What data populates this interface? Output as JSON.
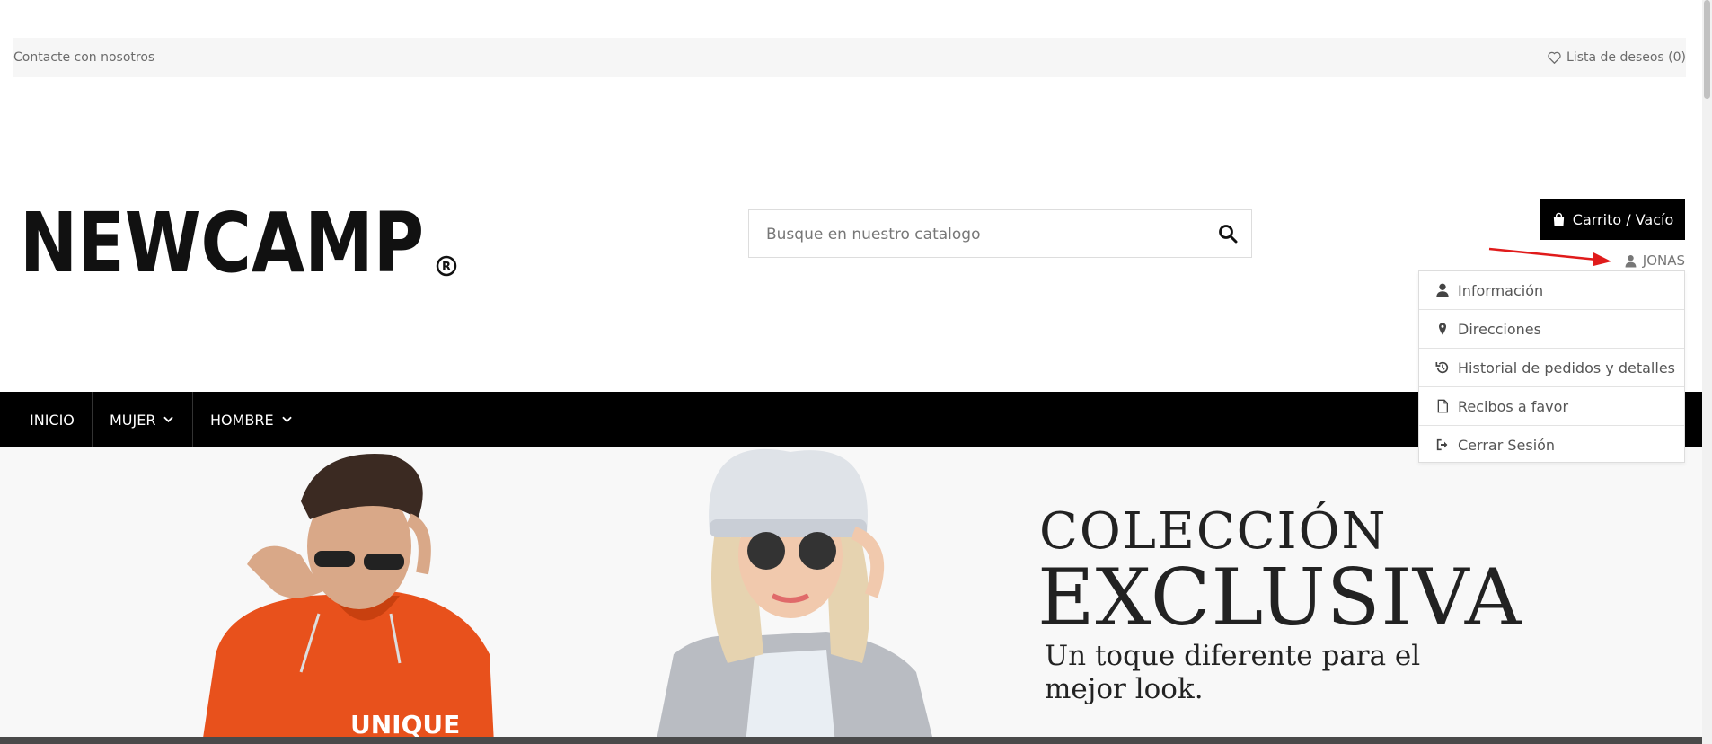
{
  "topbar": {
    "contact": "Contacte con nosotros",
    "wishlist": "Lista de deseos (0)"
  },
  "header": {
    "logo": "NEWCAMP",
    "search_placeholder": "Busque en nuestro catalogo",
    "cart": "Carrito / Vacío",
    "user": "JONAS"
  },
  "account_menu": [
    {
      "label": "Información",
      "icon": "user-icon"
    },
    {
      "label": "Direcciones",
      "icon": "map-marker-icon"
    },
    {
      "label": "Historial de pedidos y detalles",
      "icon": "history-icon"
    },
    {
      "label": "Recibos a favor",
      "icon": "file-icon"
    },
    {
      "label": "Cerrar Sesión",
      "icon": "sign-out-icon"
    }
  ],
  "nav": {
    "items": [
      "INICIO",
      "MUJER",
      "HOMBRE"
    ]
  },
  "hero": {
    "title_line1": "COLECCIÓN",
    "title_line2": "EXCLUSIVA",
    "subtitle": "Un toque diferente para el mejor look."
  },
  "colors": {
    "nav_bg": "#000000",
    "cart_bg": "#000000",
    "arrow": "#e01b1b",
    "hoodie": "#e8511c"
  }
}
